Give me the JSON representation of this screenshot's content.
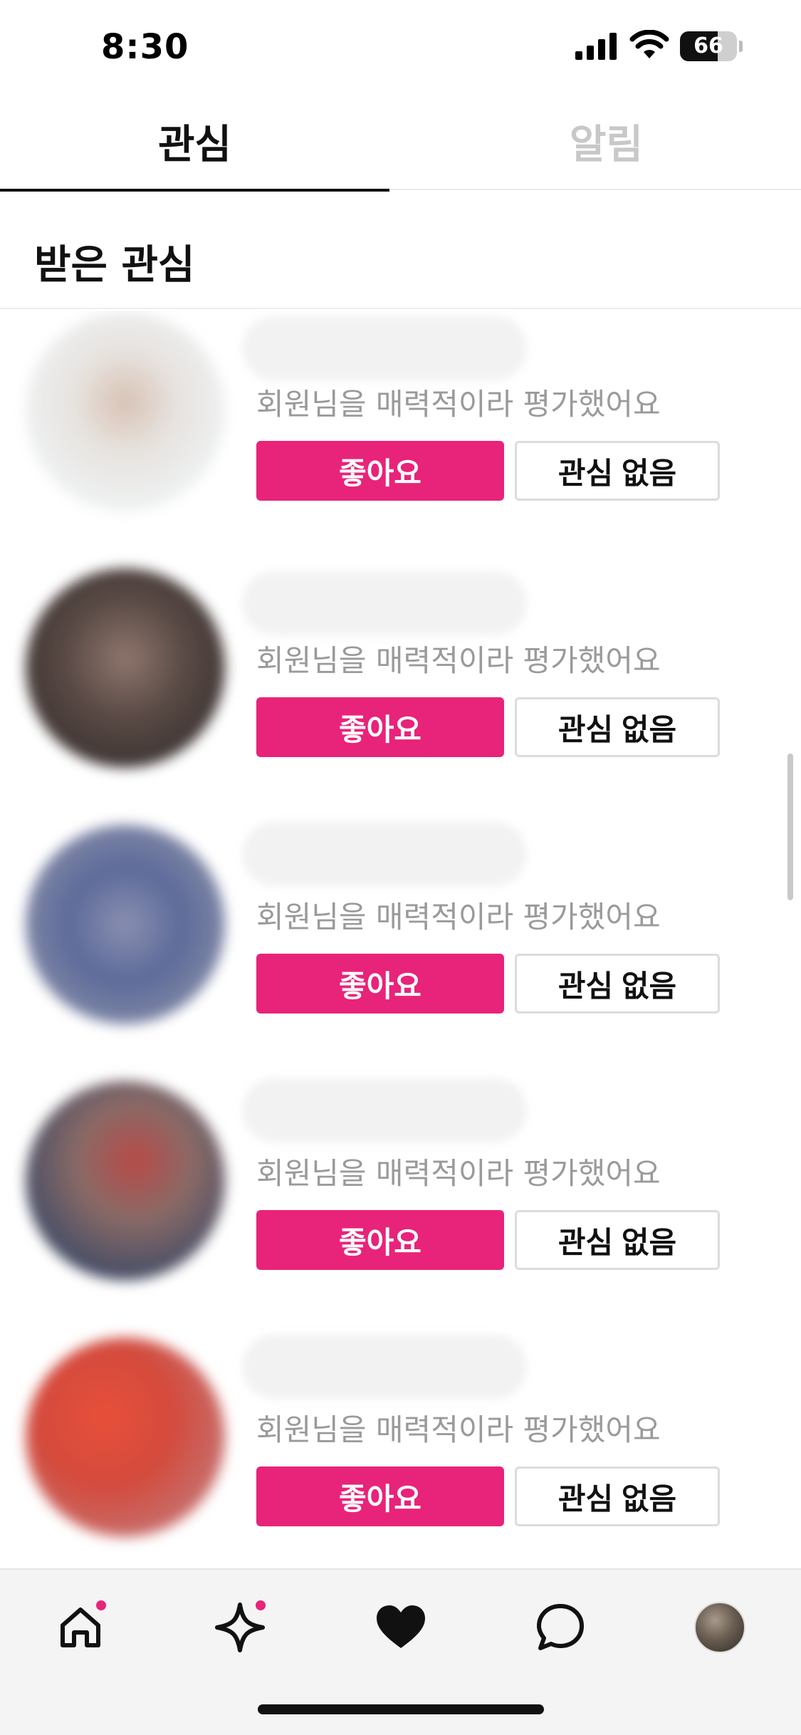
{
  "status_bar": {
    "time": "8:30",
    "battery_level": "66",
    "battery_fraction": 0.66
  },
  "tabs": [
    {
      "label": "관심",
      "active": true
    },
    {
      "label": "알림",
      "active": false
    }
  ],
  "section": {
    "title": "받은 관심"
  },
  "items": [
    {
      "message": "회원님을 매력적이라 평가했어요",
      "like_label": "좋아요",
      "pass_label": "관심 없음"
    },
    {
      "message": "회원님을 매력적이라 평가했어요",
      "like_label": "좋아요",
      "pass_label": "관심 없음"
    },
    {
      "message": "회원님을 매력적이라 평가했어요",
      "like_label": "좋아요",
      "pass_label": "관심 없음"
    },
    {
      "message": "회원님을 매력적이라 평가했어요",
      "like_label": "좋아요",
      "pass_label": "관심 없음"
    },
    {
      "message": "회원님을 매력적이라 평가했어요",
      "like_label": "좋아요",
      "pass_label": "관심 없음"
    }
  ],
  "bottom_nav": [
    {
      "icon": "home-icon",
      "badge": true
    },
    {
      "icon": "sparkle-icon",
      "badge": true
    },
    {
      "icon": "heart-icon",
      "badge": false,
      "active": true
    },
    {
      "icon": "chat-bubble-icon",
      "badge": false
    },
    {
      "icon": "profile-avatar",
      "badge": false
    }
  ],
  "colors": {
    "accent": "#e8237a",
    "inactive_tab": "#c8c8c8",
    "message_gray": "#9a9a9a"
  }
}
